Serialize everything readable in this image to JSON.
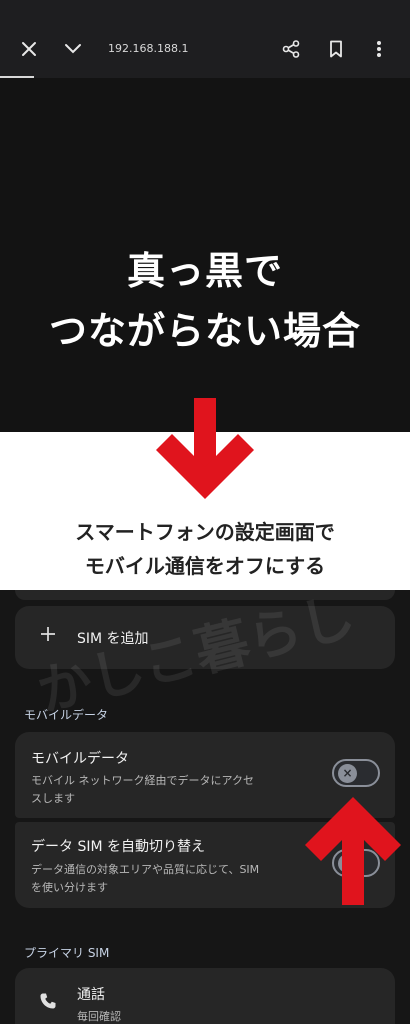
{
  "browser": {
    "url": "192.168.188.1",
    "icons": [
      "close-icon",
      "chevron-down-icon",
      "share-icon",
      "bookmark-icon",
      "more-vert-icon"
    ]
  },
  "hero": {
    "line1": "真っ黒で",
    "line2": "つながらない場合"
  },
  "caption": {
    "line1": "スマートフォンの設定画面で",
    "line2": "モバイル通信をオフにする"
  },
  "watermark": "かしこ暮らし",
  "settings": {
    "add_sim": "SIM を追加",
    "mobile_data_section": "モバイルデータ",
    "mobile_data": {
      "title": "モバイルデータ",
      "summary_line1": "モバイル ネットワーク経由でデータにアクセ",
      "summary_line2": "スします",
      "toggle_on": false
    },
    "auto_switch": {
      "title": "データ SIM を自動切り替え",
      "summary_line1": "データ通信の対象エリアや品質に応じて、SIM",
      "summary_line2": "を使い分けます",
      "toggle_on": false
    },
    "primary_sim_section": "プライマリ SIM",
    "calls": {
      "title": "通話",
      "summary": "毎回確認"
    }
  },
  "colors": {
    "arrow": "#e0141d",
    "hero_bg": "#131313",
    "settings_bg": "#161616",
    "card_bg": "#262626"
  }
}
